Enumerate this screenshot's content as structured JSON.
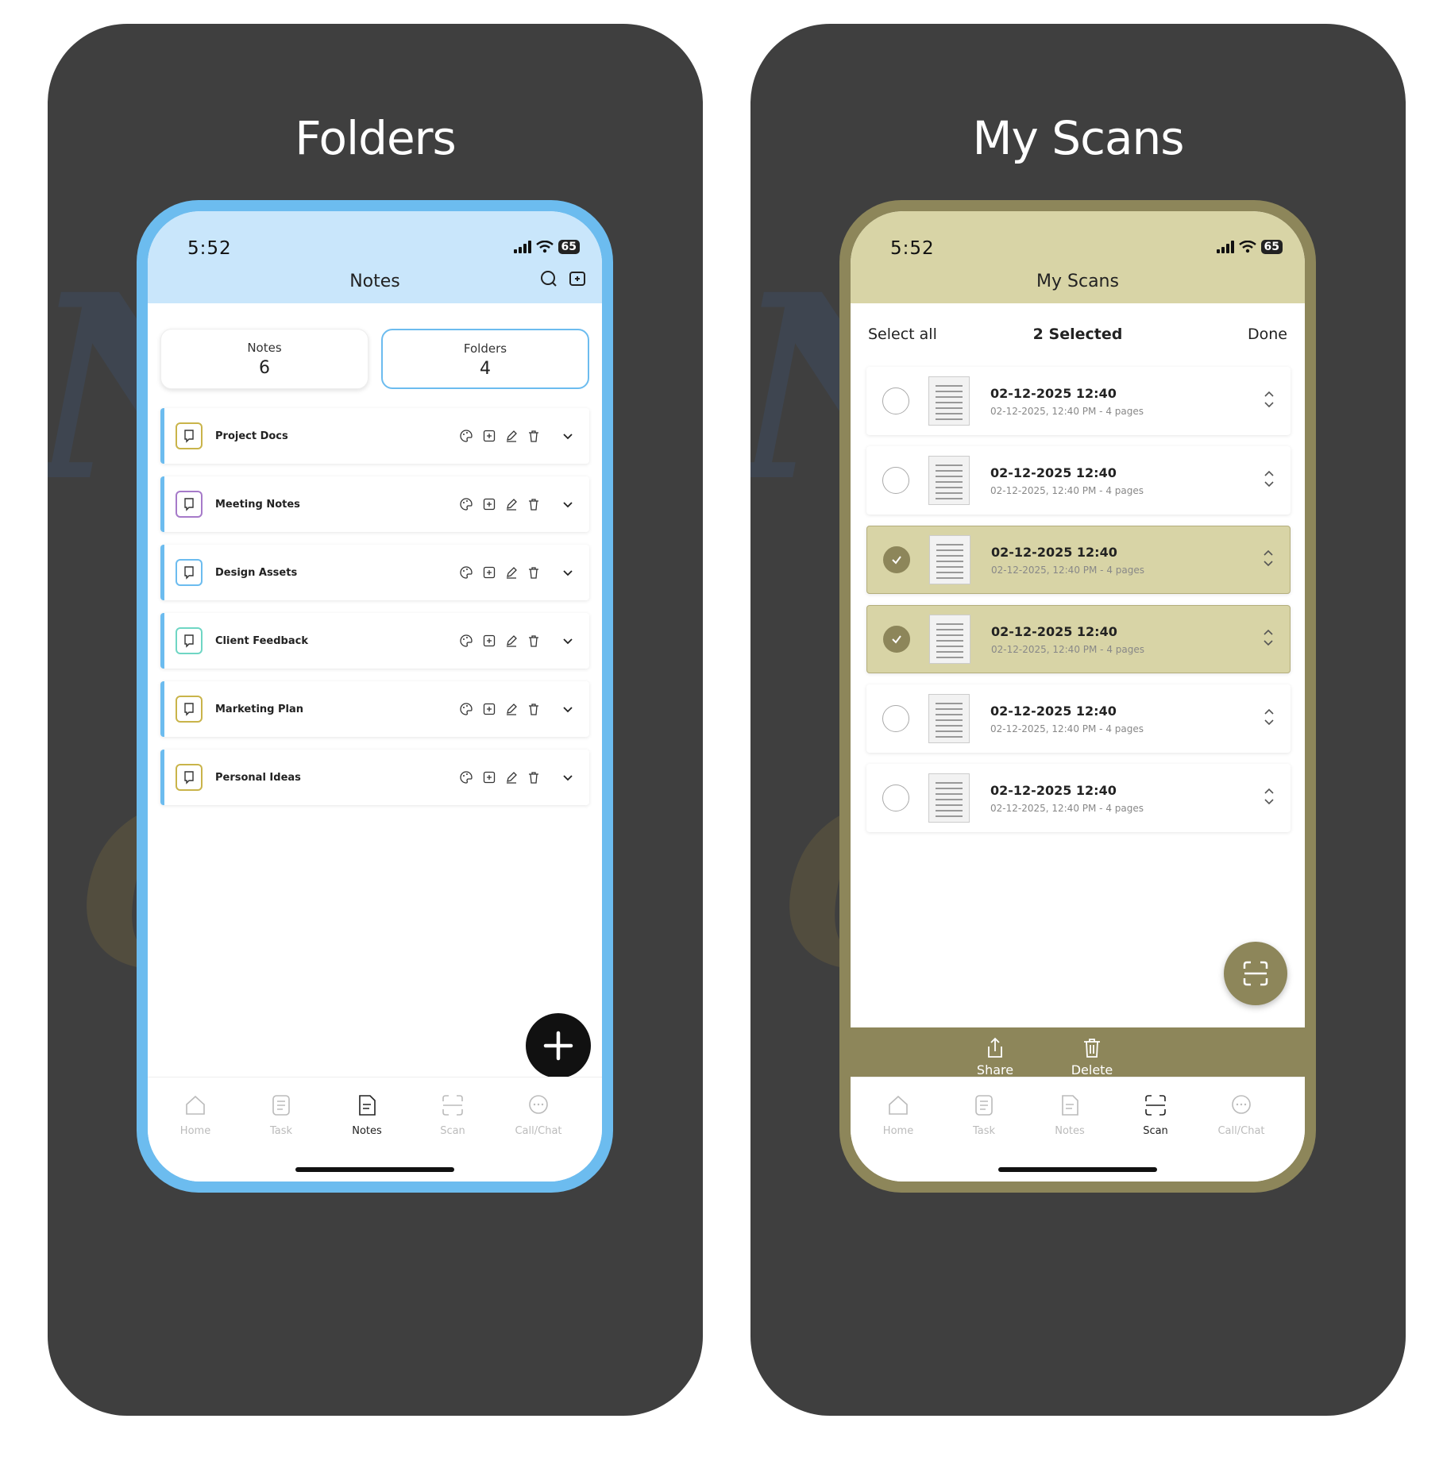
{
  "left_panel": {
    "title": "Folders",
    "status": {
      "time": "5:52",
      "battery": "65"
    },
    "header_title": "Notes",
    "segments": [
      {
        "label": "Notes",
        "count": "6"
      },
      {
        "label": "Folders",
        "count": "4"
      }
    ],
    "folders": [
      {
        "name": "Project Docs",
        "color": "#c9b44a"
      },
      {
        "name": "Meeting Notes",
        "color": "#a67ac9"
      },
      {
        "name": "Design Assets",
        "color": "#6cbcef"
      },
      {
        "name": "Client Feedback",
        "color": "#6fd6c4"
      },
      {
        "name": "Marketing Plan",
        "color": "#c9b44a"
      },
      {
        "name": "Personal Ideas",
        "color": "#c9b44a"
      }
    ],
    "tabs": [
      {
        "label": "Home",
        "icon": "home-icon"
      },
      {
        "label": "Task",
        "icon": "task-icon"
      },
      {
        "label": "Notes",
        "icon": "notes-icon",
        "active": true
      },
      {
        "label": "Scan",
        "icon": "scan-icon"
      },
      {
        "label": "Call/Chat",
        "icon": "chat-icon"
      }
    ]
  },
  "right_panel": {
    "title": "My Scans",
    "status": {
      "time": "5:52",
      "battery": "65"
    },
    "header_title": "My Scans",
    "select_all": "Select all",
    "selected_count": "2 Selected",
    "done": "Done",
    "scans": [
      {
        "title": "02-12-2025 12:40",
        "subtitle": "02-12-2025, 12:40 PM - 4 pages",
        "selected": false
      },
      {
        "title": "02-12-2025 12:40",
        "subtitle": "02-12-2025, 12:40 PM - 4 pages",
        "selected": false
      },
      {
        "title": "02-12-2025 12:40",
        "subtitle": "02-12-2025, 12:40 PM - 4 pages",
        "selected": true
      },
      {
        "title": "02-12-2025 12:40",
        "subtitle": "02-12-2025, 12:40 PM - 4 pages",
        "selected": true
      },
      {
        "title": "02-12-2025 12:40",
        "subtitle": "02-12-2025, 12:40 PM - 4 pages",
        "selected": false
      },
      {
        "title": "02-12-2025 12:40",
        "subtitle": "02-12-2025, 12:40 PM - 4 pages",
        "selected": false
      }
    ],
    "actions": [
      {
        "label": "Share",
        "icon": "share-icon"
      },
      {
        "label": "Delete",
        "icon": "trash-icon"
      }
    ],
    "tabs": [
      {
        "label": "Home",
        "icon": "home-icon"
      },
      {
        "label": "Task",
        "icon": "task-icon"
      },
      {
        "label": "Notes",
        "icon": "notes-icon"
      },
      {
        "label": "Scan",
        "icon": "scan-icon",
        "active": true
      },
      {
        "label": "Call/Chat",
        "icon": "chat-icon"
      }
    ]
  },
  "colors": {
    "blue_accent": "#6cbcef",
    "olive_accent": "#8d865a",
    "olive_light": "#d8d4a6",
    "panel_bg": "#3f3f3f"
  }
}
